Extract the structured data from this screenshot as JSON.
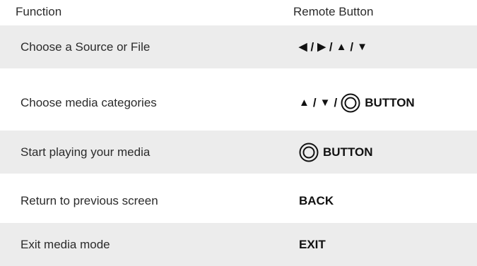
{
  "header": {
    "function": "Function",
    "remote_button": "Remote Button"
  },
  "rows": [
    {
      "function": "Choose a Source or File",
      "arrows": [
        "◀",
        "▶",
        "▲",
        "▼"
      ],
      "separator": "/"
    },
    {
      "function": "Choose media categories",
      "arrows": [
        "▲",
        "▼"
      ],
      "separator": "/",
      "icon": "ok-button-icon",
      "button_word": "BUTTON"
    },
    {
      "function": "Start playing your media",
      "icon": "ok-button-icon",
      "button_word": "BUTTON"
    },
    {
      "function": "Return to previous screen",
      "button": "BACK"
    },
    {
      "function": "Exit media mode",
      "button": "EXIT"
    }
  ],
  "colors": {
    "row_shade": "#ececec",
    "text": "#2b2b2b"
  }
}
